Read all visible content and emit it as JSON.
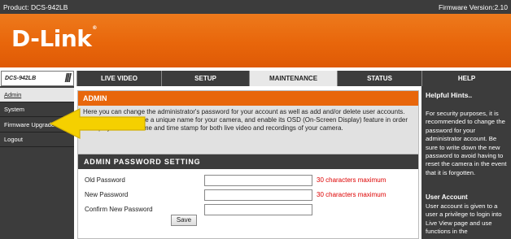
{
  "topbar": {
    "product": "Product: DCS-942LB",
    "firmware": "Firmware Version:2.10"
  },
  "brand": {
    "logo": "D-Link",
    "accent": "#e8660b",
    "dark": "#3c3c3c"
  },
  "model": "DCS-942LB",
  "tabs": [
    {
      "label": "LIVE VIDEO"
    },
    {
      "label": "SETUP"
    },
    {
      "label": "MAINTENANCE",
      "active": true
    },
    {
      "label": "STATUS"
    },
    {
      "label": "HELP"
    }
  ],
  "sidebar": {
    "items": [
      {
        "label": "Admin",
        "active": true
      },
      {
        "label": "System"
      },
      {
        "label": "Firmware Upgrade"
      },
      {
        "label": "Logout"
      }
    ]
  },
  "admin_panel": {
    "title": "ADMIN",
    "description": "Here you can change the administrator's password for your account as well as add and/or delete user accounts. You can also configure a unique name for your camera, and enable its OSD (On-Screen Display) feature in order to display camera name and time stamp for both live video and recordings of your camera."
  },
  "password_panel": {
    "title": "ADMIN PASSWORD SETTING",
    "fields": [
      {
        "label": "Old Password",
        "value": "",
        "hint": "30 characters maximum"
      },
      {
        "label": "New Password",
        "value": "",
        "hint": "30 characters maximum"
      },
      {
        "label": "Confirm New Password",
        "value": "",
        "hint": ""
      }
    ],
    "save_label": "Save"
  },
  "help": {
    "title": "Helpful Hints..",
    "body": "For security purposes, it is recommended to change the password for your administrator account. Be sure to write down the new password to avoid having to reset the camera in the event that it is forgotten.",
    "subtitle": "User Account",
    "subbody": "User account is given to a user a privilege to login into Live View page and use functions in the"
  },
  "annotation": {
    "icon": "yellow-arrow-pointer",
    "target": "Firmware Upgrade",
    "color": "#f5d000"
  }
}
